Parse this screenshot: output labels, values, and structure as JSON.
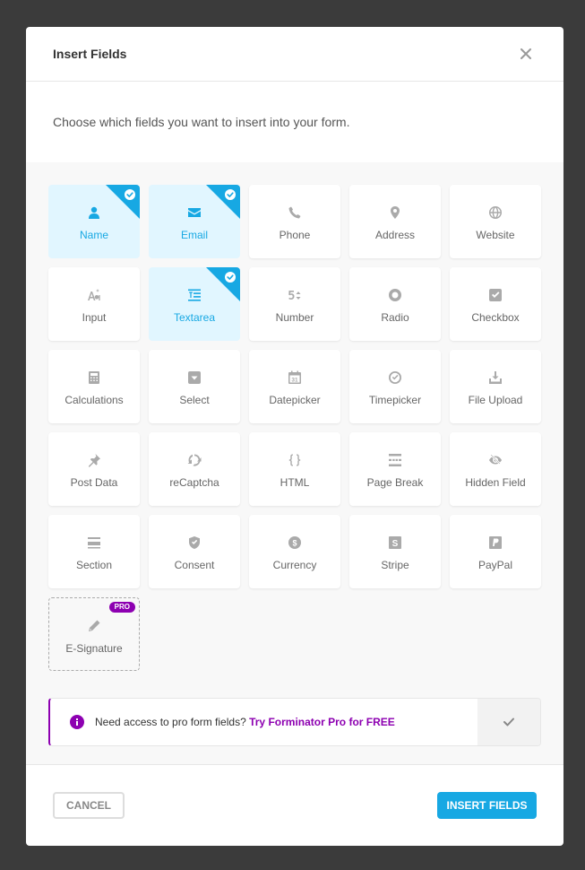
{
  "modal": {
    "title": "Insert Fields",
    "description": "Choose which fields you want to insert into your form."
  },
  "colors": {
    "accent": "#17a8e3",
    "selected_bg": "#e1f6ff",
    "pro": "#8d00b1"
  },
  "fields": [
    {
      "label": "Name",
      "icon": "user-icon",
      "selected": true
    },
    {
      "label": "Email",
      "icon": "envelope-icon",
      "selected": true
    },
    {
      "label": "Phone",
      "icon": "phone-icon",
      "selected": false
    },
    {
      "label": "Address",
      "icon": "map-pin-icon",
      "selected": false
    },
    {
      "label": "Website",
      "icon": "globe-icon",
      "selected": false
    },
    {
      "label": "Input",
      "icon": "text-input-icon",
      "selected": false
    },
    {
      "label": "Textarea",
      "icon": "textarea-icon",
      "selected": true
    },
    {
      "label": "Number",
      "icon": "number-icon",
      "selected": false
    },
    {
      "label": "Radio",
      "icon": "radio-icon",
      "selected": false
    },
    {
      "label": "Checkbox",
      "icon": "checkbox-icon",
      "selected": false
    },
    {
      "label": "Calculations",
      "icon": "calculator-icon",
      "selected": false
    },
    {
      "label": "Select",
      "icon": "select-icon",
      "selected": false
    },
    {
      "label": "Datepicker",
      "icon": "calendar-icon",
      "selected": false
    },
    {
      "label": "Timepicker",
      "icon": "clock-icon",
      "selected": false
    },
    {
      "label": "File Upload",
      "icon": "upload-icon",
      "selected": false
    },
    {
      "label": "Post Data",
      "icon": "pin-icon",
      "selected": false
    },
    {
      "label": "reCaptcha",
      "icon": "recaptcha-icon",
      "selected": false
    },
    {
      "label": "HTML",
      "icon": "code-braces-icon",
      "selected": false
    },
    {
      "label": "Page Break",
      "icon": "page-break-icon",
      "selected": false
    },
    {
      "label": "Hidden Field",
      "icon": "eye-off-icon",
      "selected": false
    },
    {
      "label": "Section",
      "icon": "section-icon",
      "selected": false
    },
    {
      "label": "Consent",
      "icon": "shield-check-icon",
      "selected": false
    },
    {
      "label": "Currency",
      "icon": "currency-icon",
      "selected": false
    },
    {
      "label": "Stripe",
      "icon": "stripe-icon",
      "selected": false
    },
    {
      "label": "PayPal",
      "icon": "paypal-icon",
      "selected": false
    },
    {
      "label": "E-Signature",
      "icon": "pen-icon",
      "selected": false,
      "pro": true,
      "badge": "PRO"
    }
  ],
  "notice": {
    "text": "Need access to pro form fields?",
    "link": "Try Forminator Pro for FREE"
  },
  "footer": {
    "cancel_label": "CANCEL",
    "insert_label": "INSERT FIELDS"
  }
}
